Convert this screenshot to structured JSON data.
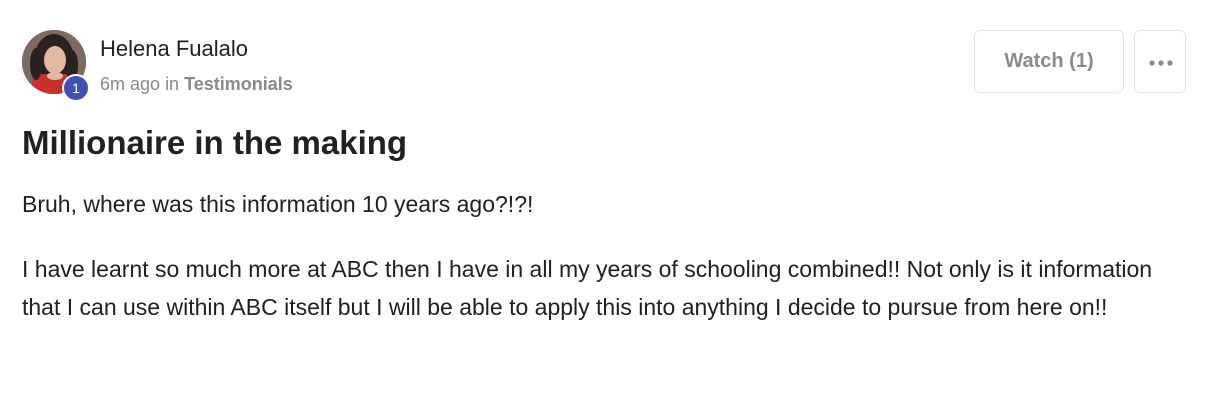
{
  "post": {
    "author": {
      "name": "Helena Fualalo",
      "level": "1"
    },
    "meta": {
      "time": "6m ago",
      "in_label": "in",
      "category": "Testimonials"
    },
    "actions": {
      "watch_label": "Watch (1)",
      "more_icon": "more-horizontal-icon"
    },
    "title": "Millionaire in the making",
    "paragraphs": [
      "Bruh, where was this information 10 years ago?!?!",
      "I have learnt so much more at ABC then I have in all my years of schooling combined!! Not only is it information that I can use within ABC itself but I will be able to apply this into anything I decide to pursue from here on!!"
    ]
  },
  "colors": {
    "badge": "#3f51b5",
    "muted_text": "#8a8a8a",
    "border": "#e4e4e4"
  }
}
